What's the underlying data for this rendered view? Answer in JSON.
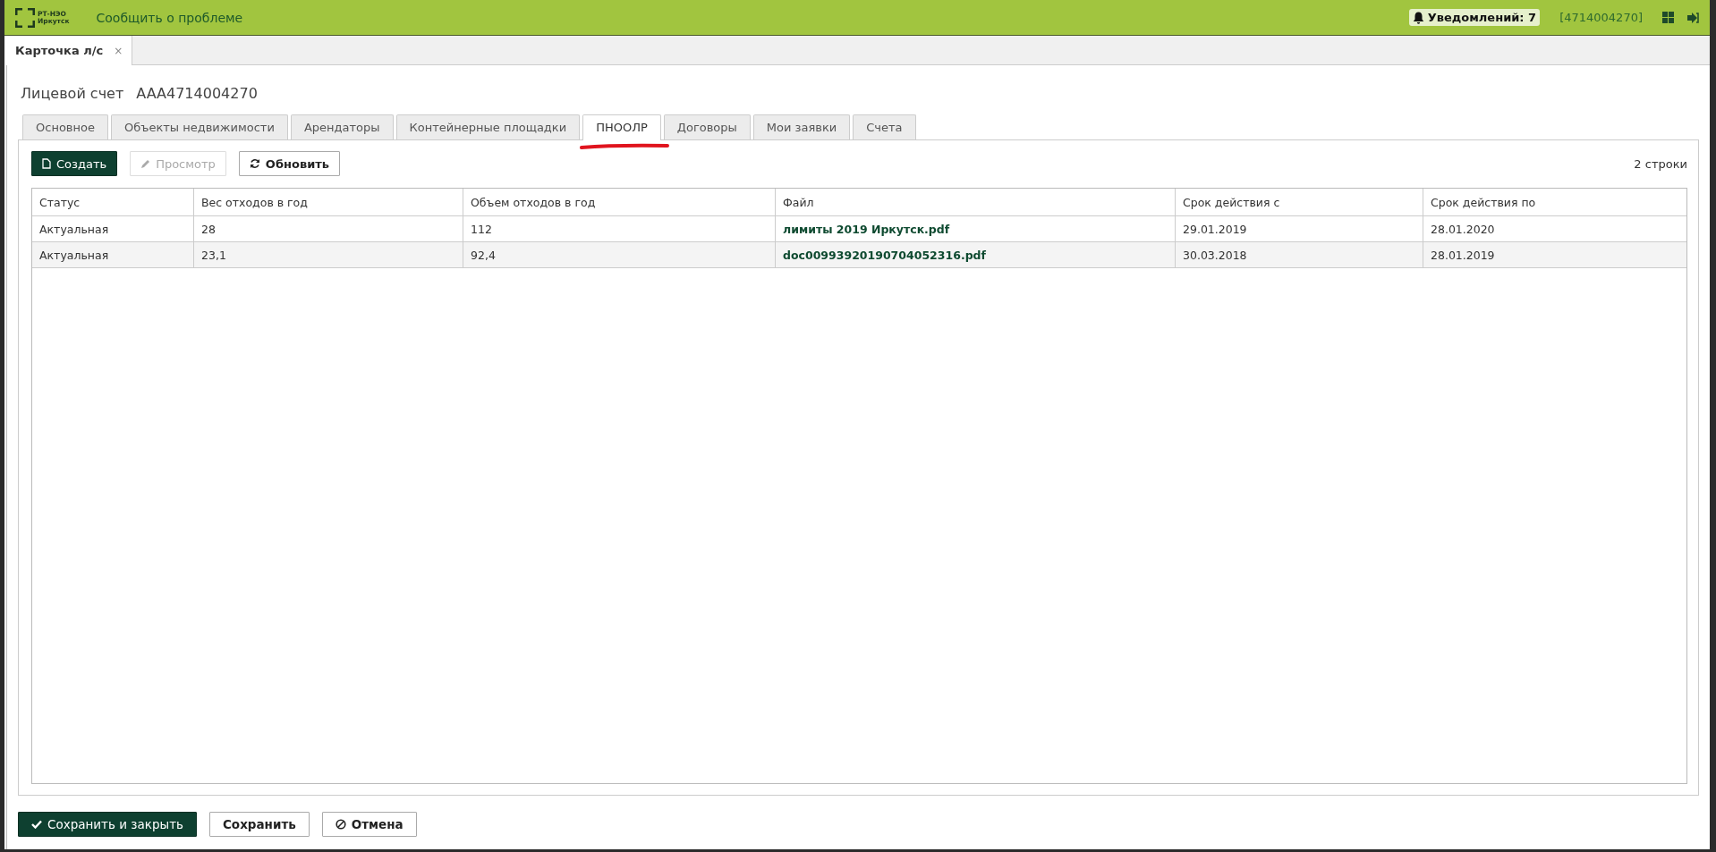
{
  "header": {
    "logo_line_1": "РТ-НЭО",
    "logo_line_2": "Иркутск",
    "report_link": "Сообщить о проблеме",
    "notifications": "Уведомлений: 7",
    "account": "[4714004270]"
  },
  "doc_tabs": [
    {
      "label": "Карточка л/с",
      "close": "×",
      "selected": true
    }
  ],
  "title": {
    "label": "Лицевой счет",
    "value": "AAA4714004270"
  },
  "tabs": [
    {
      "label": "Основное",
      "selected": false
    },
    {
      "label": "Объекты недвижимости",
      "selected": false
    },
    {
      "label": "Арендаторы",
      "selected": false
    },
    {
      "label": "Контейнерные площадки",
      "selected": false
    },
    {
      "label": "ПНООЛР",
      "selected": true
    },
    {
      "label": "Договоры",
      "selected": false
    },
    {
      "label": "Мои заявки",
      "selected": false
    },
    {
      "label": "Счета",
      "selected": false
    }
  ],
  "toolbar": {
    "buttons": [
      {
        "kind": "create",
        "label": "Создать",
        "disabled": false
      },
      {
        "kind": "view",
        "label": "Просмотр",
        "disabled": true
      },
      {
        "kind": "refresh",
        "label": "Обновить",
        "disabled": false
      }
    ],
    "row_count": "2 строки"
  },
  "table": {
    "columns": [
      "Статус",
      "Вес отходов в год",
      "Объем отходов в год",
      "Файл",
      "Срок действия с",
      "Срок действия по"
    ],
    "rows": [
      [
        "Актуальная",
        "28",
        "112",
        "лимиты 2019 Иркутск.pdf",
        "29.01.2019",
        "28.01.2020"
      ],
      [
        "Актуальная",
        "23,1",
        "92,4",
        "doc00993920190704052316.pdf",
        "30.03.2018",
        "28.01.2019"
      ]
    ]
  },
  "footer": [
    {
      "kind": "save_close",
      "label": "Сохранить и закрыть"
    },
    {
      "kind": "save",
      "label": "Сохранить"
    },
    {
      "kind": "cancel",
      "label": "Отмена"
    }
  ]
}
